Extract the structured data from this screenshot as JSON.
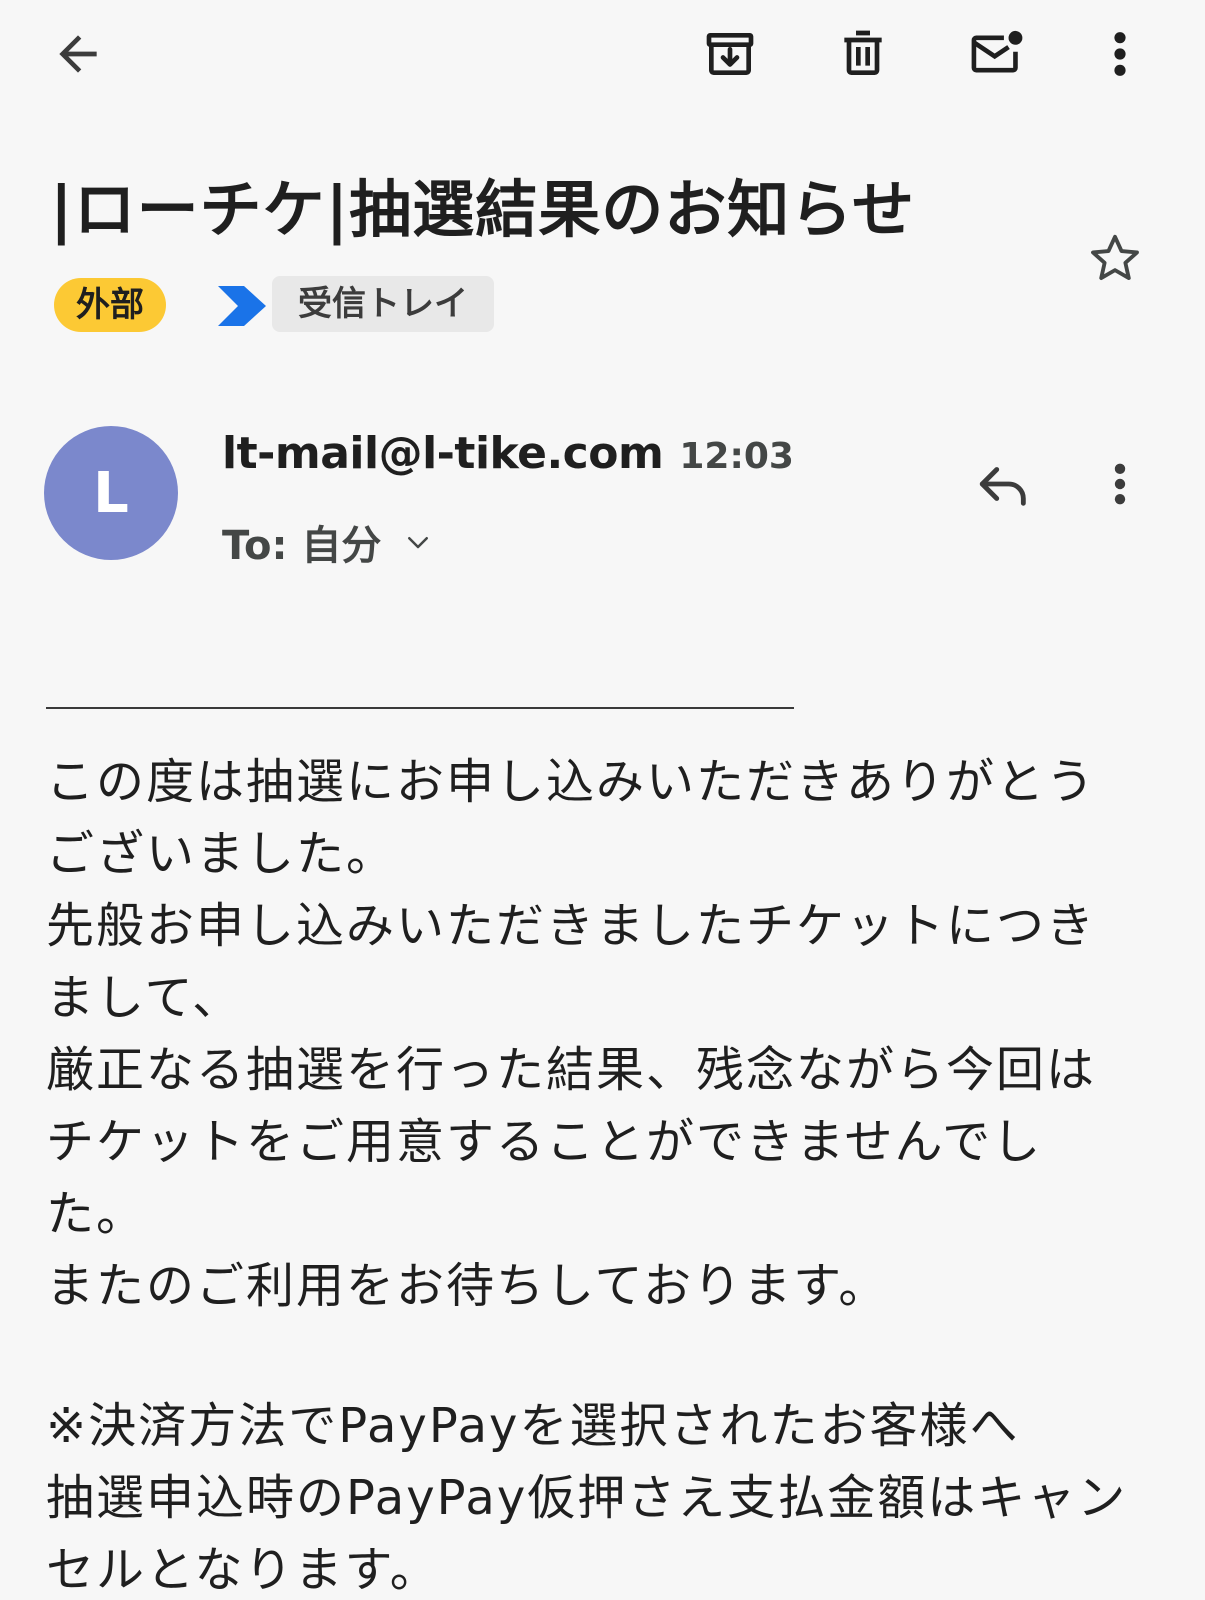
{
  "toolbar": {
    "icons": [
      "back-arrow-icon",
      "archive-icon",
      "trash-icon",
      "mark-unread-icon",
      "more-vert-icon"
    ]
  },
  "email": {
    "subject": "|ローチケ|抽選結果のお知らせ",
    "labels": {
      "external": "外部",
      "inbox": "受信トレイ"
    },
    "sender": {
      "avatar_letter": "L",
      "avatar_color": "#7b88cc",
      "address": "lt-mail@l-tike.com",
      "time": "12:03",
      "to": "To: 自分"
    },
    "body": {
      "paragraph1": [
        "この度は抽選にお申し込みいただきありがとう",
        "ございました。",
        "先般お申し込みいただきましたチケットにつき",
        "まして、",
        "厳正なる抽選を行った結果、残念ながら今回は",
        "チケットをご用意することができませんでし",
        "た。",
        "またのご利用をお待ちしております。"
      ],
      "paragraph2": [
        "※決済方法でPayPayを選択されたお客様へ",
        "抽選申込時のPayPay仮押さえ支払金額はキャン",
        "セルとなります。"
      ]
    }
  },
  "colors": {
    "external_label": "#fcc934",
    "importance_marker": "#1a73e8",
    "background": "#f7f7f7"
  }
}
